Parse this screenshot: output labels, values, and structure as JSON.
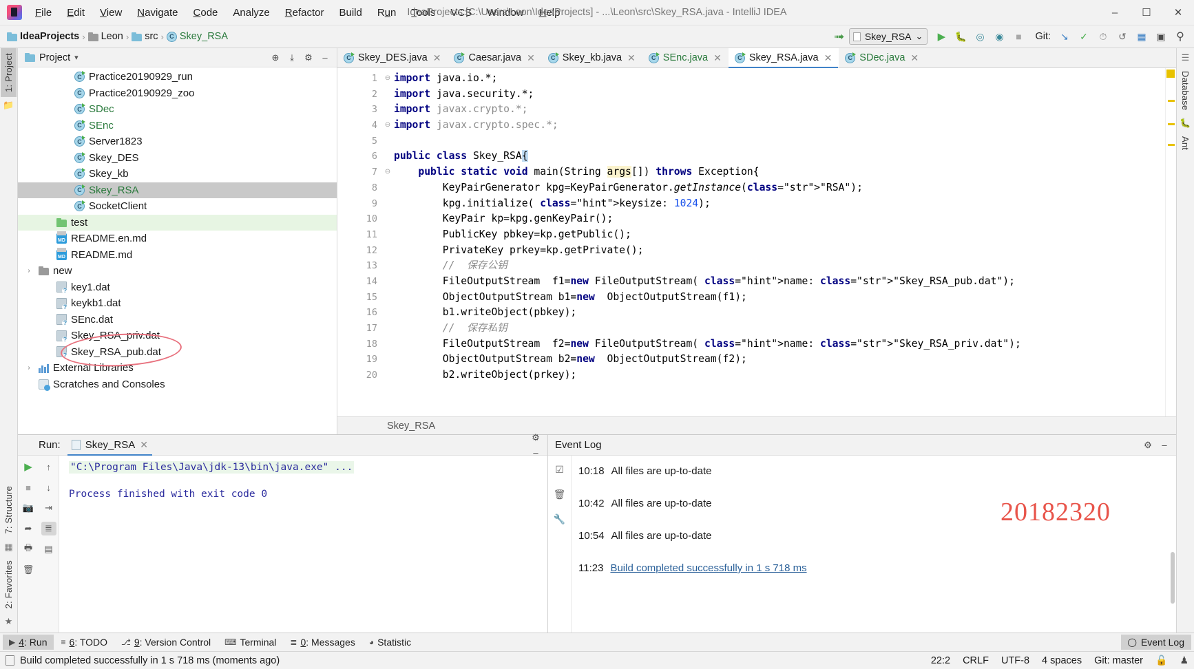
{
  "titlebar": {
    "menus": [
      "File",
      "Edit",
      "View",
      "Navigate",
      "Code",
      "Analyze",
      "Refactor",
      "Build",
      "Run",
      "Tools",
      "VCS",
      "Window",
      "Help"
    ],
    "window_title": "IdeaProjects [C:\\Users\\Leon\\IdeaProjects] - ...\\Leon\\src\\Skey_RSA.java - IntelliJ IDEA",
    "minimize": "–",
    "maximize": "☐",
    "close": "✕"
  },
  "navbar": {
    "breadcrumbs": [
      "IdeaProjects",
      "Leon",
      "src",
      "Skey_RSA"
    ],
    "separator": "›",
    "run_config": "Skey_RSA",
    "run_config_caret": "⌄",
    "git_label": "Git:",
    "buttons": {
      "back_arrow": "↖",
      "run": "▶",
      "debug": "⚙",
      "run_coverage": "▷",
      "profile": "◔",
      "stop": "■",
      "update_project": "↙",
      "commit": "✓",
      "history": "◴",
      "rollback": "↶",
      "settings": "▤",
      "layout": "▣",
      "search": "⌕"
    }
  },
  "left_rail": {
    "project": "1: Project",
    "structure": "7: Structure",
    "favorites": "2: Favorites"
  },
  "right_rail": {
    "database": "Database",
    "ant": "Ant"
  },
  "project_panel": {
    "title": "Project",
    "caret": "▾",
    "icons": {
      "locate": "⊕",
      "collapse": "⤓",
      "settings": "⚙",
      "hide": "–"
    },
    "tree": [
      {
        "label": "Practice20190929_run",
        "type": "class",
        "indent": 2,
        "runnable": true
      },
      {
        "label": "Practice20190929_zoo",
        "type": "class",
        "indent": 2,
        "runnable": false
      },
      {
        "label": "SDec",
        "type": "class",
        "indent": 2,
        "runnable": true,
        "green": true
      },
      {
        "label": "SEnc",
        "type": "class",
        "indent": 2,
        "runnable": true,
        "green": true
      },
      {
        "label": "Server1823",
        "type": "class",
        "indent": 2,
        "runnable": true
      },
      {
        "label": "Skey_DES",
        "type": "class",
        "indent": 2,
        "runnable": true
      },
      {
        "label": "Skey_kb",
        "type": "class",
        "indent": 2,
        "runnable": true
      },
      {
        "label": "Skey_RSA",
        "type": "class",
        "indent": 2,
        "runnable": true,
        "green": true,
        "selected": true
      },
      {
        "label": "SocketClient",
        "type": "class",
        "indent": 2,
        "runnable": true
      },
      {
        "label": "test",
        "type": "folder-green",
        "indent": 1,
        "greenbg": true
      },
      {
        "label": "README.en.md",
        "type": "md",
        "indent": 1
      },
      {
        "label": "README.md",
        "type": "md",
        "indent": 1
      },
      {
        "label": "new",
        "type": "folder",
        "indent": 0,
        "arrow": "›"
      },
      {
        "label": "key1.dat",
        "type": "dat",
        "indent": 1
      },
      {
        "label": "keykb1.dat",
        "type": "dat",
        "indent": 1
      },
      {
        "label": "SEnc.dat",
        "type": "dat",
        "indent": 1
      },
      {
        "label": "Skey_RSA_priv.dat",
        "type": "dat",
        "indent": 1,
        "circled": true
      },
      {
        "label": "Skey_RSA_pub.dat",
        "type": "dat",
        "indent": 1,
        "circled": true
      },
      {
        "label": "External Libraries",
        "type": "lib",
        "indent": 0,
        "arrow": "›"
      },
      {
        "label": "Scratches and Consoles",
        "type": "scratch",
        "indent": 0
      }
    ],
    "annotation_color": "#e8717e"
  },
  "editor": {
    "tabs": [
      {
        "label": "Skey_DES.java",
        "active": false,
        "green": false
      },
      {
        "label": "Caesar.java",
        "active": false,
        "green": false
      },
      {
        "label": "Skey_kb.java",
        "active": false,
        "green": false
      },
      {
        "label": "SEnc.java",
        "active": false,
        "green": true
      },
      {
        "label": "Skey_RSA.java",
        "active": true,
        "green": false
      },
      {
        "label": "SDec.java",
        "active": false,
        "green": true
      }
    ],
    "tab_close": "✕",
    "breadcrumb": "Skey_RSA",
    "line_numbers": [
      1,
      2,
      3,
      4,
      5,
      6,
      7,
      8,
      9,
      10,
      11,
      12,
      13,
      14,
      15,
      16,
      17,
      18,
      19,
      20
    ],
    "code": [
      "import java.io.*;",
      "import java.security.*;",
      "import javax.crypto.*;",
      "import javax.crypto.spec.*;",
      "",
      "public class Skey_RSA{",
      "    public static void main(String args[]) throws Exception{",
      "        KeyPairGenerator kpg=KeyPairGenerator.getInstance(\"RSA\");",
      "        kpg.initialize( keysize: 1024);",
      "        KeyPair kp=kpg.genKeyPair();",
      "        PublicKey pbkey=kp.getPublic();",
      "        PrivateKey prkey=kp.getPrivate();",
      "        //  保存公钥",
      "        FileOutputStream  f1=new FileOutputStream( name: \"Skey_RSA_pub.dat\");",
      "        ObjectOutputStream b1=new  ObjectOutputStream(f1);",
      "        b1.writeObject(pbkey);",
      "        //  保存私钥",
      "        FileOutputStream  f2=new FileOutputStream( name: \"Skey_RSA_priv.dat\");",
      "        ObjectOutputStream b2=new  ObjectOutputStream(f2);",
      "        b2.writeObject(prkey);"
    ]
  },
  "run_panel": {
    "label": "Run:",
    "tab": "Skey_RSA",
    "tab_close": "✕",
    "settings_icon": "⚙",
    "hide_icon": "–",
    "tools": [
      "▶",
      "■",
      "▣",
      "⮊",
      "▦",
      "⬇"
    ],
    "tools2": [
      "↑",
      "↓",
      "↩",
      "≡",
      "☰"
    ],
    "console": [
      "\"C:\\Program Files\\Java\\jdk-13\\bin\\java.exe\" ...",
      "",
      "Process finished with exit code 0"
    ]
  },
  "event_panel": {
    "title": "Event Log",
    "settings_icon": "⚙",
    "hide_icon": "–",
    "tools": [
      "☑",
      "Ὕ1",
      "ὒ7"
    ],
    "events": [
      {
        "time": "10:18",
        "message": "All files are up-to-date",
        "link": false
      },
      {
        "time": "10:42",
        "message": "All files are up-to-date",
        "link": false
      },
      {
        "time": "10:54",
        "message": "All files are up-to-date",
        "link": false
      },
      {
        "time": "11:23",
        "message": "Build completed successfully in 1 s 718 ms",
        "link": true
      }
    ],
    "watermark": "20182320",
    "watermark_color": "#e8544a"
  },
  "toolwindow_bar": {
    "items": [
      {
        "icon": "▶",
        "label": "4: Run",
        "active": true
      },
      {
        "icon": "≡",
        "label": "6: TODO",
        "active": false
      },
      {
        "icon": "⎇",
        "label": "9: Version Control",
        "active": false
      },
      {
        "icon": "⌨",
        "label": "Terminal",
        "active": false
      },
      {
        "icon": "≣",
        "label": "0: Messages",
        "active": false
      },
      {
        "icon": "◕",
        "label": "Statistic",
        "active": false
      }
    ],
    "event_log": {
      "icon": "◯",
      "label": "Event Log"
    }
  },
  "statusbar": {
    "message": "Build completed successfully in 1 s 718 ms (moments ago)",
    "caret": "22:2",
    "line_sep": "CRLF",
    "encoding": "UTF-8",
    "indent": "4 spaces",
    "branch": "Git: master",
    "lock_icon": "ὑ3",
    "person_icon": "♟"
  }
}
